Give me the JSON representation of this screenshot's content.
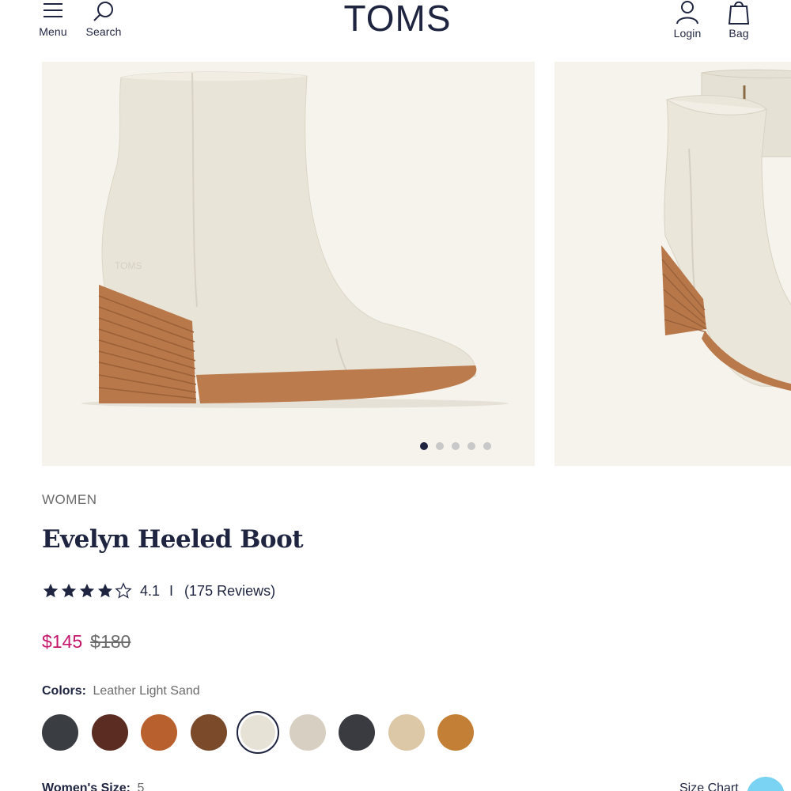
{
  "header": {
    "logo": "TOMS",
    "menu_label": "Menu",
    "search_label": "Search",
    "login_label": "Login",
    "bag_label": "Bag"
  },
  "gallery": {
    "total_images": 5,
    "active_index": 0,
    "background": "#f6f3ec"
  },
  "product": {
    "category": "WOMEN",
    "title": "Evelyn Heeled Boot",
    "rating": {
      "stars": 4.1,
      "value_text": "4.1",
      "separator": "I",
      "reviews_text": "(175 Reviews)"
    },
    "price_sale": "$145",
    "price_original": "$180",
    "colors_label": "Colors:",
    "selected_color": "Leather Light Sand",
    "swatches": [
      {
        "name": "swatch-black",
        "color": "#3a3d42"
      },
      {
        "name": "swatch-dark-brown",
        "color": "#5a2c22"
      },
      {
        "name": "swatch-cognac",
        "color": "#b9602f"
      },
      {
        "name": "swatch-chestnut",
        "color": "#7b4a2b"
      },
      {
        "name": "swatch-light-sand",
        "color": "#e7e2d6",
        "selected": true
      },
      {
        "name": "swatch-sand-taupe",
        "color": "#d8cfc3"
      },
      {
        "name": "swatch-charcoal",
        "color": "#3a3b40"
      },
      {
        "name": "swatch-beige-suede",
        "color": "#dcc7a6"
      },
      {
        "name": "swatch-tan-suede",
        "color": "#c47f36"
      }
    ],
    "size_label": "Women's Size:",
    "size_value": "5",
    "size_chart_label": "Size Chart"
  },
  "colors": {
    "brand_navy": "#1f2540",
    "sale_pink": "#c5156a",
    "chat": "#7ad3f3"
  }
}
